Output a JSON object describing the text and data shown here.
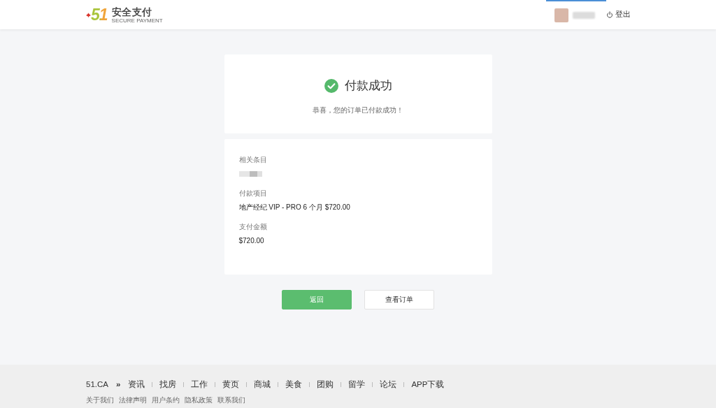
{
  "header": {
    "logo": {
      "mark": "51",
      "name": "安全支付",
      "tagline": "SECURE PAYMENT"
    },
    "user_menu": {
      "active": true
    },
    "logout": "登出"
  },
  "result": {
    "title": "付款成功",
    "message": "恭喜，您的订单已付款成功！"
  },
  "details": [
    {
      "label": "相关条目",
      "kind": "redacted"
    },
    {
      "label": "付款项目",
      "kind": "text",
      "value": "地产经纪 VIP - PRO 6 个月 $720.00"
    },
    {
      "label": "支付金额",
      "kind": "text",
      "value": "$720.00"
    }
  ],
  "buttons": [
    {
      "label": "返回",
      "kind": "primary"
    },
    {
      "label": "查看订单",
      "kind": "secondary"
    }
  ],
  "footer": {
    "brand": "51.CA",
    "separator": "»",
    "links": [
      "资讯",
      "找房",
      "工作",
      "黄页",
      "商城",
      "美食",
      "团购",
      "留学",
      "论坛",
      "APP下载"
    ],
    "bottom_links": [
      "关于我们",
      "法律声明",
      "用户条约",
      "隐私政策",
      "联系我们"
    ]
  }
}
